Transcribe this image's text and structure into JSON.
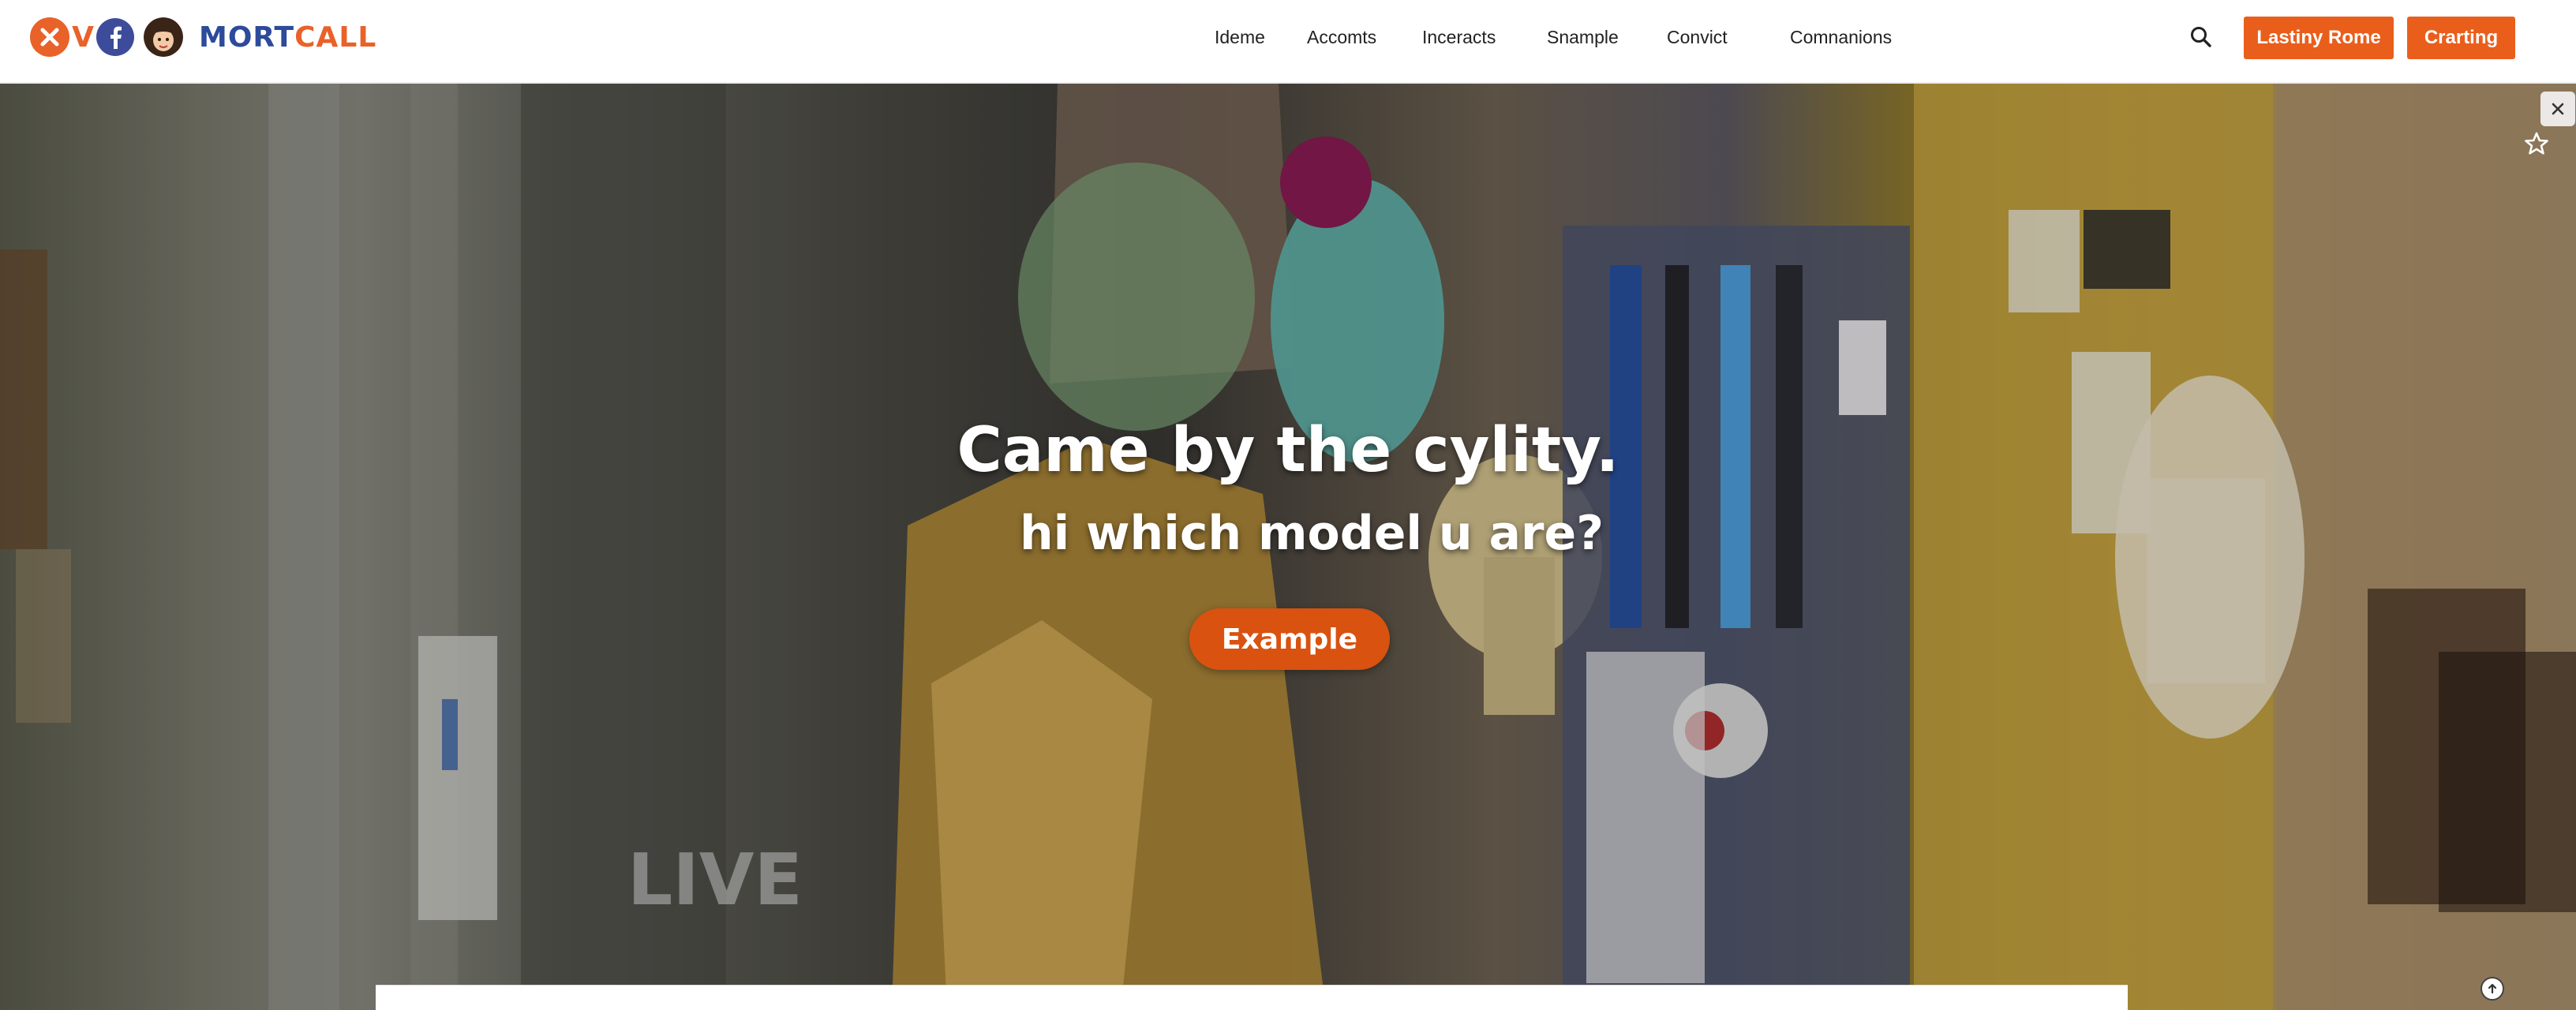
{
  "brand": {
    "name_part1": "MORT",
    "name_part2": "CALL",
    "v_letter": "V",
    "colors": {
      "primary_orange": "#ea5e1c",
      "brand_blue": "#2d4a9b",
      "facebook_blue": "#3d4c9a"
    }
  },
  "nav": {
    "items": [
      {
        "label": "Ideme"
      },
      {
        "label": "Accomts"
      },
      {
        "label": "Inceracts"
      },
      {
        "label": "Snample"
      },
      {
        "label": "Convict"
      },
      {
        "label": "Comnanions"
      }
    ]
  },
  "header": {
    "search_icon": "search-icon",
    "button_primary": "Lastiny Rome",
    "button_secondary": "Crarting"
  },
  "hero": {
    "title": "Came by the cylity.",
    "subtitle": "hi which model u are?",
    "cta_label": "Example"
  },
  "overlay_controls": {
    "close_icon": "close-icon",
    "favorite_icon": "star-icon",
    "scroll_icon": "arrow-up-icon"
  }
}
